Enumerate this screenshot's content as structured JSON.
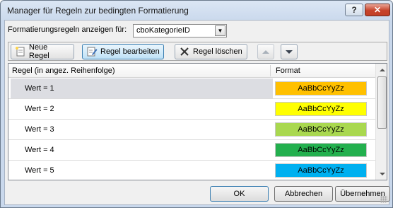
{
  "window": {
    "title": "Manager für Regeln zur bedingten Formatierung",
    "help_label": "?",
    "close_label": "✕"
  },
  "filter": {
    "label": "Formatierungsregeln anzeigen für:",
    "value": "cboKategorieID"
  },
  "toolbar": {
    "new_label": "Neue Regel",
    "edit_label": "Regel bearbeiten",
    "delete_label": "Regel löschen"
  },
  "list": {
    "col_rule": "Regel (in angez. Reihenfolge)",
    "col_format": "Format",
    "rows": [
      {
        "label": "Wert = 1",
        "preview": "AaBbCcYyZz",
        "color": "#FFC000"
      },
      {
        "label": "Wert = 2",
        "preview": "AaBbCcYyZz",
        "color": "#FFFF00"
      },
      {
        "label": "Wert = 3",
        "preview": "AaBbCcYyZz",
        "color": "#A9D84F"
      },
      {
        "label": "Wert = 4",
        "preview": "AaBbCcYyZz",
        "color": "#23B04E"
      },
      {
        "label": "Wert = 5",
        "preview": "AaBbCcYyZz",
        "color": "#00B0F0"
      }
    ]
  },
  "footer": {
    "ok_label": "OK",
    "cancel_label": "Abbrechen",
    "apply_label": "Übernehmen"
  }
}
